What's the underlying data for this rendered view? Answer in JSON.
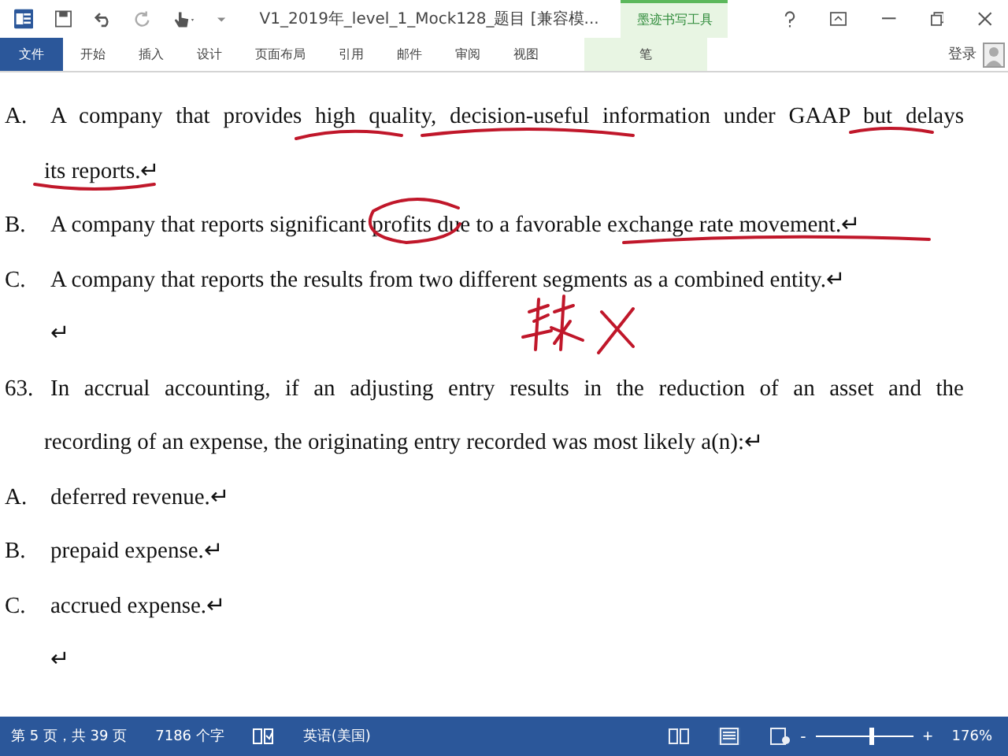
{
  "window": {
    "title": "V1_2019年_level_1_Mock128_题目 [兼容模...",
    "context_tab_group": "墨迹书写工具"
  },
  "tabs": [
    {
      "label": "文件",
      "kind": "file",
      "selected": false
    },
    {
      "label": "开始",
      "kind": "tab",
      "selected": false
    },
    {
      "label": "插入",
      "kind": "tab",
      "selected": false
    },
    {
      "label": "设计",
      "kind": "tab",
      "selected": false
    },
    {
      "label": "页面布局",
      "kind": "tab",
      "selected": false
    },
    {
      "label": "引用",
      "kind": "tab",
      "selected": false
    },
    {
      "label": "邮件",
      "kind": "tab",
      "selected": false
    },
    {
      "label": "审阅",
      "kind": "tab",
      "selected": false
    },
    {
      "label": "视图",
      "kind": "tab",
      "selected": false
    },
    {
      "label": "笔",
      "kind": "context",
      "selected": false
    }
  ],
  "account": {
    "sign_in": "登录"
  },
  "document": {
    "paragraphs": [
      {
        "label": "A.",
        "lines": [
          "A company that provides high quality, decision-useful information under GAAP but delays",
          "its reports.↵"
        ]
      },
      {
        "label": "B.",
        "lines": [
          "A company that reports significant profits due to a favorable exchange rate movement.↵"
        ]
      },
      {
        "label": "C.",
        "lines": [
          "A company that reports the results from two different segments as a combined entity.↵"
        ]
      },
      {
        "lines": [
          "↵"
        ]
      },
      {
        "label": "63.",
        "lines": [
          "In accrual accounting, if an adjusting entry results in the reduction of an asset and the",
          "recording of an expense, the originating entry recorded was most likely a(n):↵"
        ]
      },
      {
        "label": "A.",
        "lines": [
          "deferred revenue.↵"
        ]
      },
      {
        "label": "B.",
        "lines": [
          "prepaid expense.↵"
        ]
      },
      {
        "label": "C.",
        "lines": [
          "accrued expense.↵"
        ]
      },
      {
        "lines": [
          "↵"
        ]
      }
    ]
  },
  "status_bar": {
    "page": "第 5 页，共 39 页",
    "words": "7186 个字",
    "language": "英语(美国)",
    "zoom": {
      "zoom_out": "-",
      "zoom_in": "+",
      "level": 0.56,
      "reading": "176%"
    }
  }
}
